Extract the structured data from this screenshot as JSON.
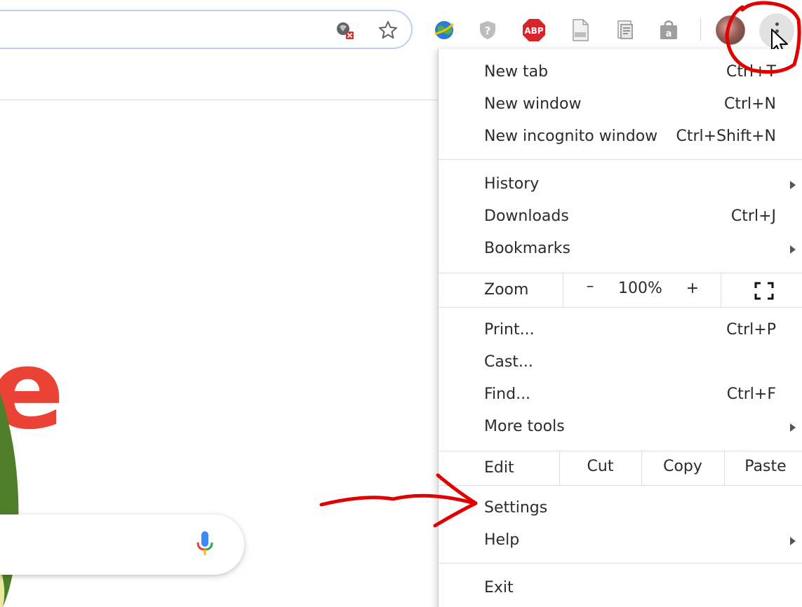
{
  "colors": {
    "annotation_red": "#e00000",
    "google_red": "#ea4335",
    "omnibox_border": "#bdd0ee",
    "menu_text": "#2b2b2b"
  },
  "toolbar": {
    "omnibox_icons": [
      "site-settings-blocked-icon",
      "bookmark-star-icon"
    ],
    "extensions": [
      {
        "name": "idm-globe-icon"
      },
      {
        "name": "shield-extension-icon"
      },
      {
        "name": "adblock-plus-icon",
        "text": "ABP"
      },
      {
        "name": "pdf-extension-icon"
      },
      {
        "name": "document-extension-icon"
      },
      {
        "name": "shopping-bag-extension-icon",
        "text": "a"
      }
    ],
    "profile_icon": "profile-avatar",
    "menu_icon": "three-dot-menu-icon"
  },
  "page": {
    "logo_fragment": "e",
    "mic_icon": "microphone-icon"
  },
  "menu": {
    "section1": [
      {
        "label": "New tab",
        "shortcut": "Ctrl+T"
      },
      {
        "label": "New window",
        "shortcut": "Ctrl+N"
      },
      {
        "label": "New incognito window",
        "shortcut": "Ctrl+Shift+N"
      }
    ],
    "section2": [
      {
        "label": "History",
        "has_submenu": true
      },
      {
        "label": "Downloads",
        "shortcut": "Ctrl+J"
      },
      {
        "label": "Bookmarks",
        "has_submenu": true
      }
    ],
    "zoom": {
      "label": "Zoom",
      "minus": "–",
      "level": "100%",
      "plus": "+"
    },
    "section3": [
      {
        "label": "Print...",
        "shortcut": "Ctrl+P"
      },
      {
        "label": "Cast..."
      },
      {
        "label": "Find...",
        "shortcut": "Ctrl+F"
      },
      {
        "label": "More tools",
        "has_submenu": true
      }
    ],
    "edit": {
      "label": "Edit",
      "cut": "Cut",
      "copy": "Copy",
      "paste": "Paste"
    },
    "section4": [
      {
        "label": "Settings"
      },
      {
        "label": "Help",
        "has_submenu": true
      }
    ],
    "exit": {
      "label": "Exit"
    }
  }
}
